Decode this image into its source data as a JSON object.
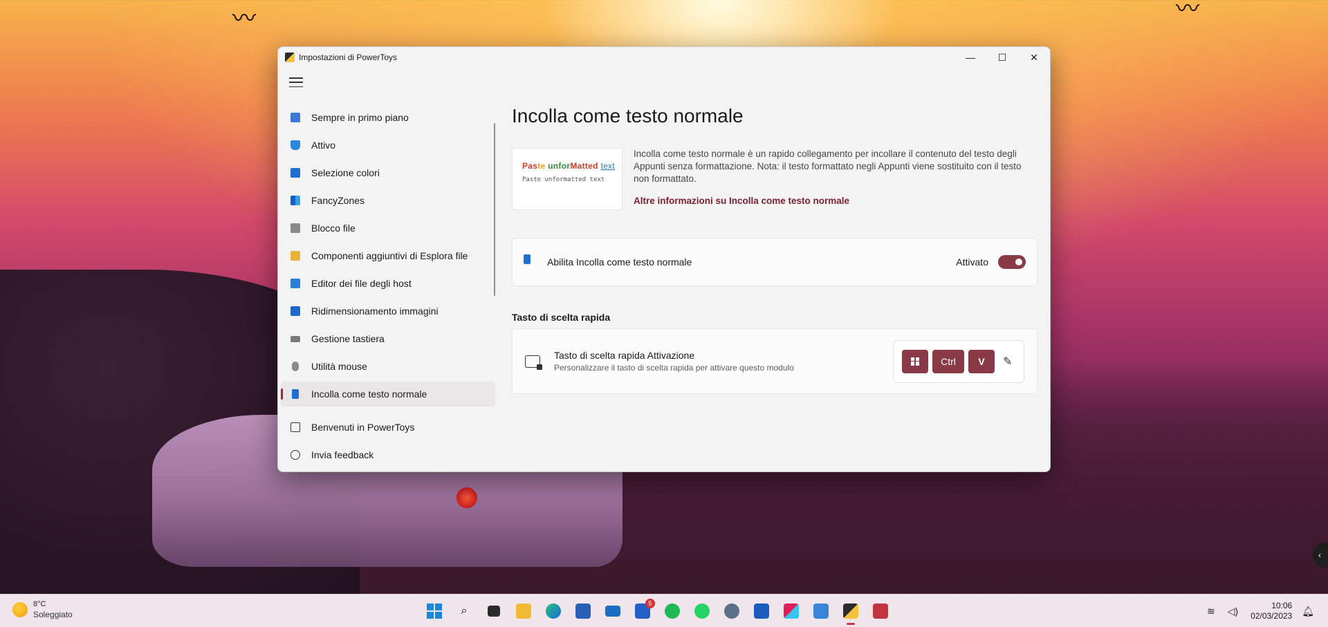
{
  "window": {
    "title": "Impostazioni di PowerToys",
    "minimize": "—",
    "maximize": "☐",
    "close": "✕"
  },
  "sidebar": {
    "items": [
      {
        "label": "Sempre in primo piano",
        "icon": "always-on-top-icon",
        "color": "#3b78d8"
      },
      {
        "label": "Attivo",
        "icon": "awake-icon",
        "color": "#2c86d9"
      },
      {
        "label": "Selezione colori",
        "icon": "color-picker-icon",
        "color": "#1f6ed0"
      },
      {
        "label": "FancyZones",
        "icon": "fancyzones-icon",
        "color": "#35a0e0"
      },
      {
        "label": "Blocco file",
        "icon": "file-locksmith-icon",
        "color": "#8a8a8a"
      },
      {
        "label": "Componenti aggiuntivi di Esplora file",
        "icon": "file-explorer-icon",
        "color": "#e8b23a"
      },
      {
        "label": "Editor dei file degli host",
        "icon": "hosts-editor-icon",
        "color": "#2a7fd4"
      },
      {
        "label": "Ridimensionamento immagini",
        "icon": "image-resizer-icon",
        "color": "#2067c7"
      },
      {
        "label": "Gestione tastiera",
        "icon": "keyboard-manager-icon",
        "color": "#7a7a7a"
      },
      {
        "label": "Utilità mouse",
        "icon": "mouse-utilities-icon",
        "color": "#8a8a8a"
      },
      {
        "label": "Incolla come testo normale",
        "icon": "paste-plain-icon",
        "color": "#1e6fd0"
      }
    ],
    "footer": [
      {
        "label": "Benvenuti in PowerToys",
        "icon": "welcome-icon"
      },
      {
        "label": "Invia feedback",
        "icon": "feedback-icon"
      }
    ]
  },
  "main": {
    "title": "Incolla come testo normale",
    "hero": {
      "line1_parts": [
        "Pas",
        "te ",
        "unfor",
        "Matted ",
        "text"
      ],
      "line2": "Paste unformatted text"
    },
    "description": "Incolla come testo normale è un rapido collegamento per incollare il contenuto del testo degli Appunti senza formattazione. Nota: il testo formattato negli Appunti viene sostituito con il testo non formattato.",
    "learn_more": "Altre informazioni su Incolla come testo normale",
    "enable": {
      "label": "Abilita Incolla come testo normale",
      "state_label": "Attivato"
    },
    "shortcut_section": "Tasto di scelta rapida",
    "shortcut": {
      "title": "Tasto di scelta rapida Attivazione",
      "subtitle": "Personalizzare il tasto di scelta rapida per attivare questo modulo",
      "keys": [
        "Ctrl",
        "V"
      ]
    }
  },
  "taskbar": {
    "weather_temp": "8°C",
    "weather_desc": "Soleggiato",
    "time": "10:06",
    "date": "02/03/2023",
    "mail_badge": "5"
  },
  "colors": {
    "accent": "#8a3a47",
    "link": "#7a2232"
  }
}
